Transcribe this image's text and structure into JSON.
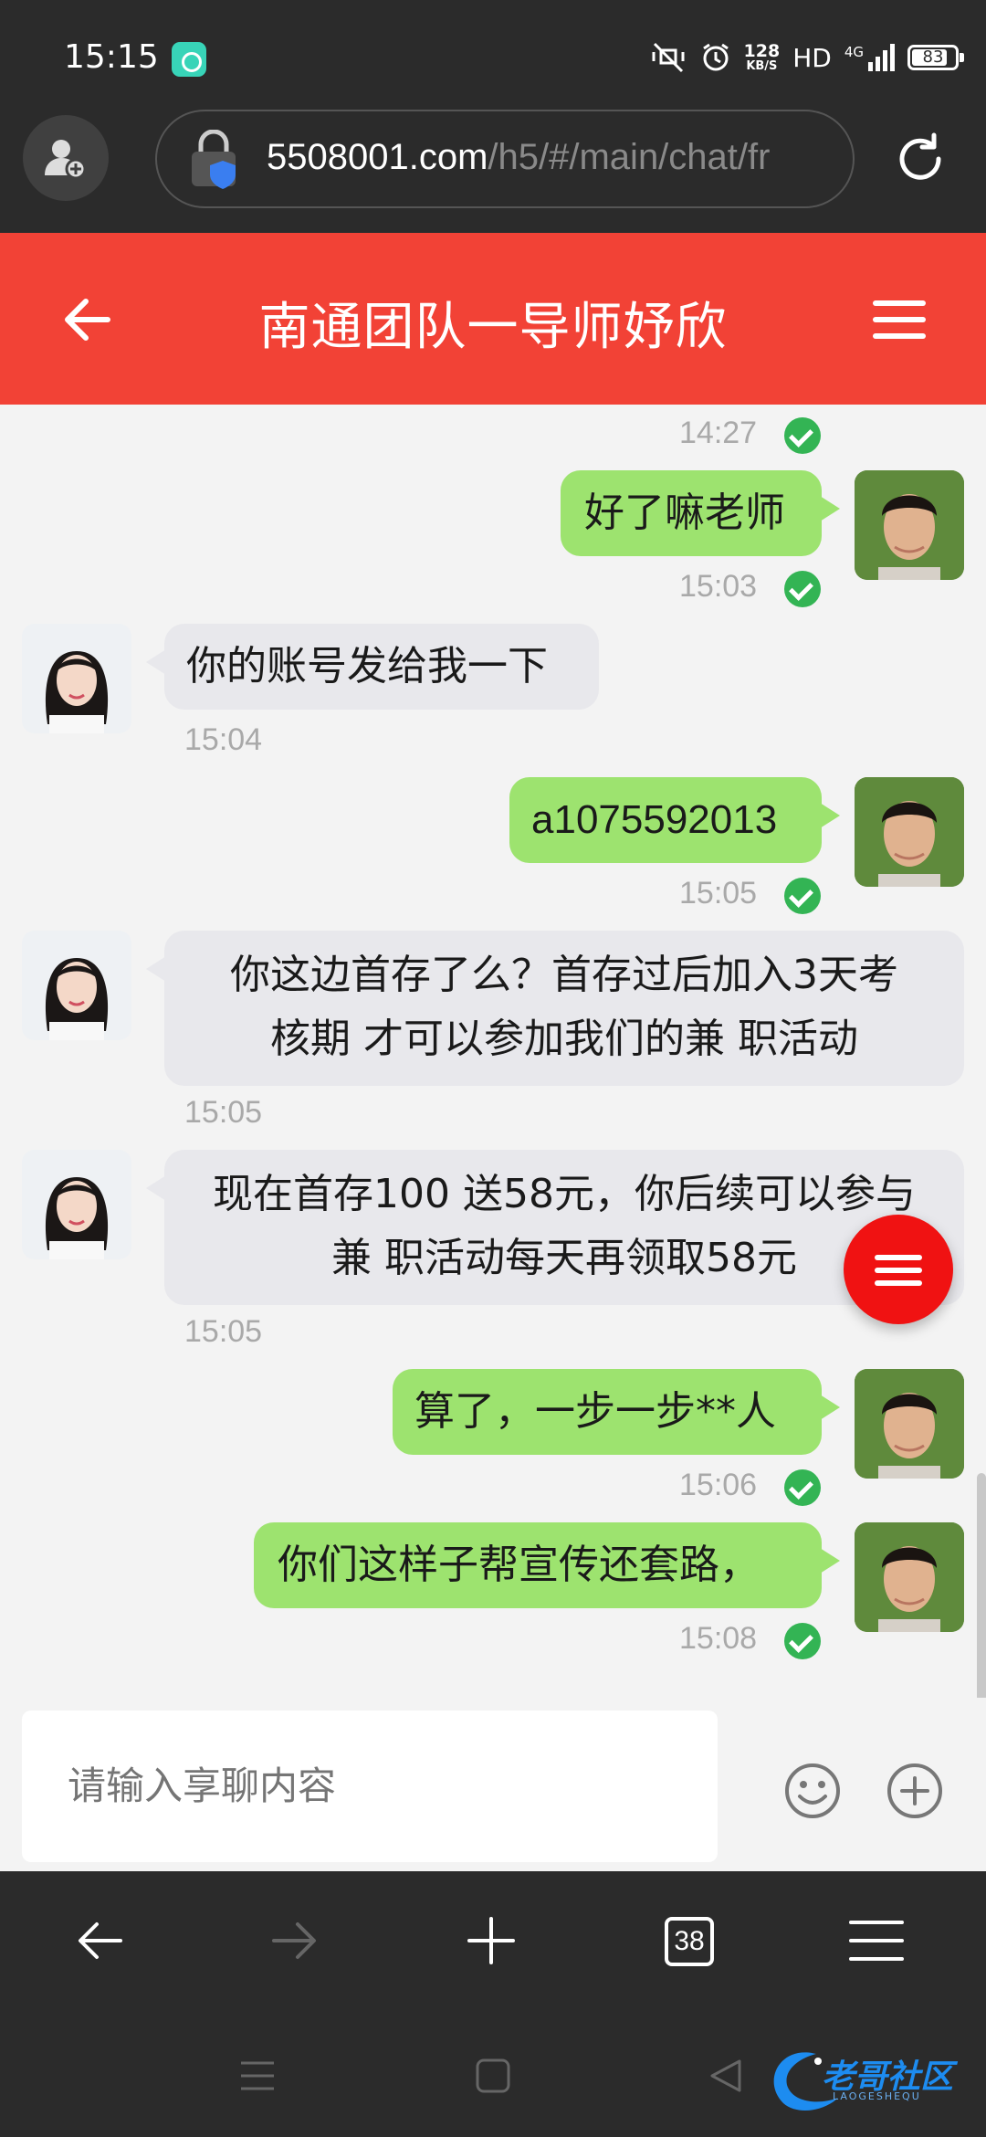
{
  "status_bar": {
    "time": "15:15",
    "net_speed": "128",
    "net_unit": "KB/S",
    "hd": "HD",
    "network": "4G",
    "battery": "83",
    "battery_level": 0.83
  },
  "browser": {
    "url_host": "5508001.com",
    "url_path": "/h5/#/main/chat/fr",
    "tab_count": "38"
  },
  "chat": {
    "title": "南通团队一导师妤欣",
    "input_placeholder": "请输入享聊内容",
    "top_timestamp": "14:27",
    "messages": [
      {
        "side": "out",
        "text": "好了嘛老师",
        "time": "15:03"
      },
      {
        "side": "in",
        "text": "你的账号发给我一下",
        "time": "15:04"
      },
      {
        "side": "out",
        "text": "a1075592013",
        "time": "15:05"
      },
      {
        "side": "in",
        "text_line1": "你这边首存了么？首存过后加入3天考",
        "text_line2": "核期 才可以参加我们的兼 职活动",
        "time": "15:05"
      },
      {
        "side": "in",
        "text_line1": "现在首存100 送58元，你后续可以参与",
        "text_line2": "兼 职活动每天再领取58元",
        "time": "15:05"
      },
      {
        "side": "out",
        "text": "算了，一步一步**人",
        "time": "15:06"
      },
      {
        "side": "out",
        "text": "你们这样子帮宣传还套路，",
        "time": "15:08"
      }
    ]
  },
  "watermark": {
    "text": "老哥社区",
    "sub": "LAOGESHEQU"
  },
  "colors": {
    "header_red": "#f24236",
    "outgoing_bubble": "#9de36f",
    "incoming_bubble": "#e8e8ec",
    "read_check": "#33b454",
    "fab_red": "#f01212"
  }
}
